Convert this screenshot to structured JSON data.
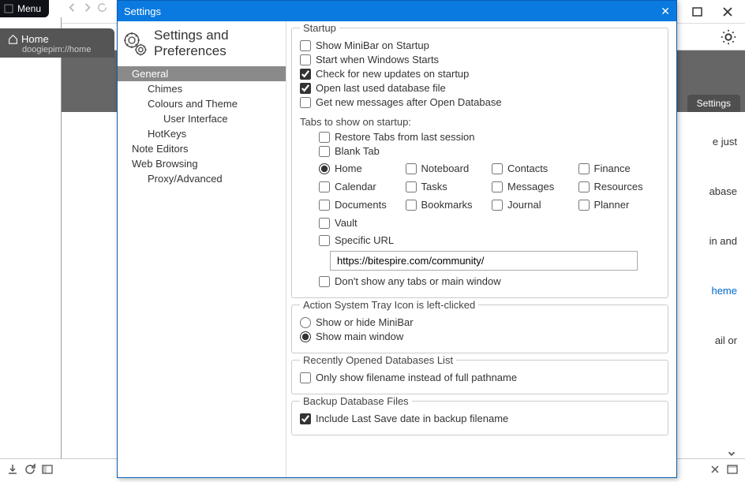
{
  "bg": {
    "menu": "Menu",
    "home_tab": {
      "title": "Home",
      "url": "doogiepim://home"
    },
    "settings_tab": "Settings",
    "partials": [
      "e just",
      "abase",
      " in and",
      "heme",
      "ail or"
    ]
  },
  "modal": {
    "title": "Settings",
    "header": "Settings and Preferences",
    "tree": {
      "general": "General",
      "chimes": "Chimes",
      "colours": "Colours and Theme",
      "ui": "User Interface",
      "hotkeys": "HotKeys",
      "noteeditors": "Note Editors",
      "web": "Web Browsing",
      "proxy": "Proxy/Advanced"
    },
    "startup": {
      "legend": "Startup",
      "show_minibar": "Show MiniBar on Startup",
      "start_windows": "Start when Windows Starts",
      "check_updates": "Check for new updates on startup",
      "open_last": "Open last used database file",
      "get_messages": "Get new messages after Open Database",
      "tabs_hdr": "Tabs to show on startup:",
      "restore_tabs": "Restore Tabs from last session",
      "blank_tab": "Blank Tab",
      "choices": {
        "home": "Home",
        "noteboard": "Noteboard",
        "contacts": "Contacts",
        "finance": "Finance",
        "calendar": "Calendar",
        "tasks": "Tasks",
        "messages": "Messages",
        "resources": "Resources",
        "documents": "Documents",
        "bookmarks": "Bookmarks",
        "journal": "Journal",
        "planner": "Planner",
        "vault": "Vault"
      },
      "specific_url": "Specific URL",
      "url_value": "https://bitespire.com/community/",
      "dont_show": "Don't show any tabs or main window"
    },
    "tray": {
      "legend": "Action System Tray Icon is left-clicked",
      "opt1": "Show or hide MiniBar",
      "opt2": "Show main window"
    },
    "recent": {
      "legend": "Recently Opened Databases List",
      "opt": "Only show filename instead of full pathname"
    },
    "backup": {
      "legend": "Backup Database Files",
      "opt": "Include Last Save date in backup filename"
    }
  }
}
